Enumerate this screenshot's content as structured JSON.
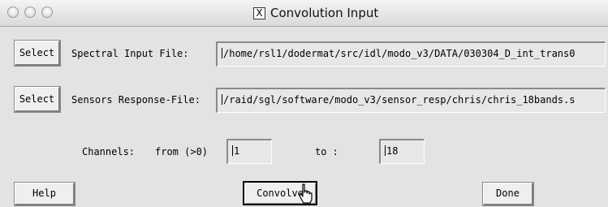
{
  "window": {
    "title": "Convolution Input",
    "title_icon": "x-window-icon"
  },
  "spectral": {
    "select_label": "Select",
    "label": "Spectral Input File:",
    "value": "/home/rsl1/dodermat/src/idl/modo_v3/DATA/030304_D_int_trans0"
  },
  "sensor": {
    "select_label": "Select",
    "label": "Sensors Response-File:",
    "value": "/raid/sgl/software/modo_v3/sensor_resp/chris/chris_18bands.s"
  },
  "channels": {
    "label": "Channels:",
    "from_label": "from (>0)",
    "from_value": "1",
    "to_label": "to :",
    "to_value": "18"
  },
  "actions": {
    "help_label": "Help",
    "convolve_label": "Convolve",
    "done_label": "Done"
  },
  "cursor": "hand-pointer-icon"
}
